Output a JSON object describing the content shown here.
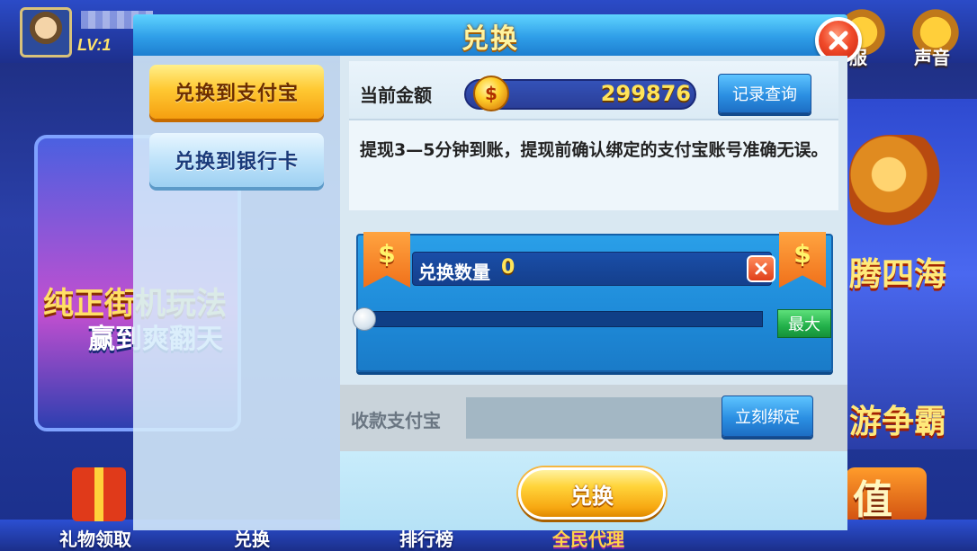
{
  "background": {
    "level": "LV:1",
    "top_icons": [
      {
        "label": "服",
        "icon": "service-icon"
      },
      {
        "label": "声音",
        "icon": "sound-icon"
      }
    ],
    "left_card_text_1": "纯正街机玩法",
    "left_card_text_2": "赢到爽翻天",
    "right_text_1": "腾四海",
    "right_text_2": "游争霸",
    "right_text_3": "值",
    "bottom_nav": [
      "礼物领取",
      "兑换",
      "排行榜",
      "全民代理"
    ]
  },
  "modal": {
    "title": "兑换",
    "close_icon": "close-icon",
    "tabs": [
      {
        "label": "兑换到支付宝",
        "active": true
      },
      {
        "label": "兑换到银行卡",
        "active": false
      }
    ],
    "balance": {
      "label": "当前金额",
      "value": "299876",
      "coin_symbol": "$",
      "records_button": "记录查询"
    },
    "notice": "提现3—5分钟到账，提现前确认绑定的支付宝账号准确无误。",
    "exchange": {
      "ribbon_symbol": "$",
      "quantity_label": "兑换数量",
      "quantity_value": "0",
      "slider_fraction": 0,
      "max_button": "最大"
    },
    "alipay": {
      "label": "收款支付宝",
      "value": "",
      "placeholder": "",
      "bind_button": "立刻绑定"
    },
    "confirm_button": "兑换"
  },
  "colors": {
    "title_bar": "#2f9ee8",
    "active_tab": "#ffc933",
    "amount_panel": "#1e8ad8",
    "confirm_button": "#ffd43a",
    "max_button": "#22b04a"
  }
}
